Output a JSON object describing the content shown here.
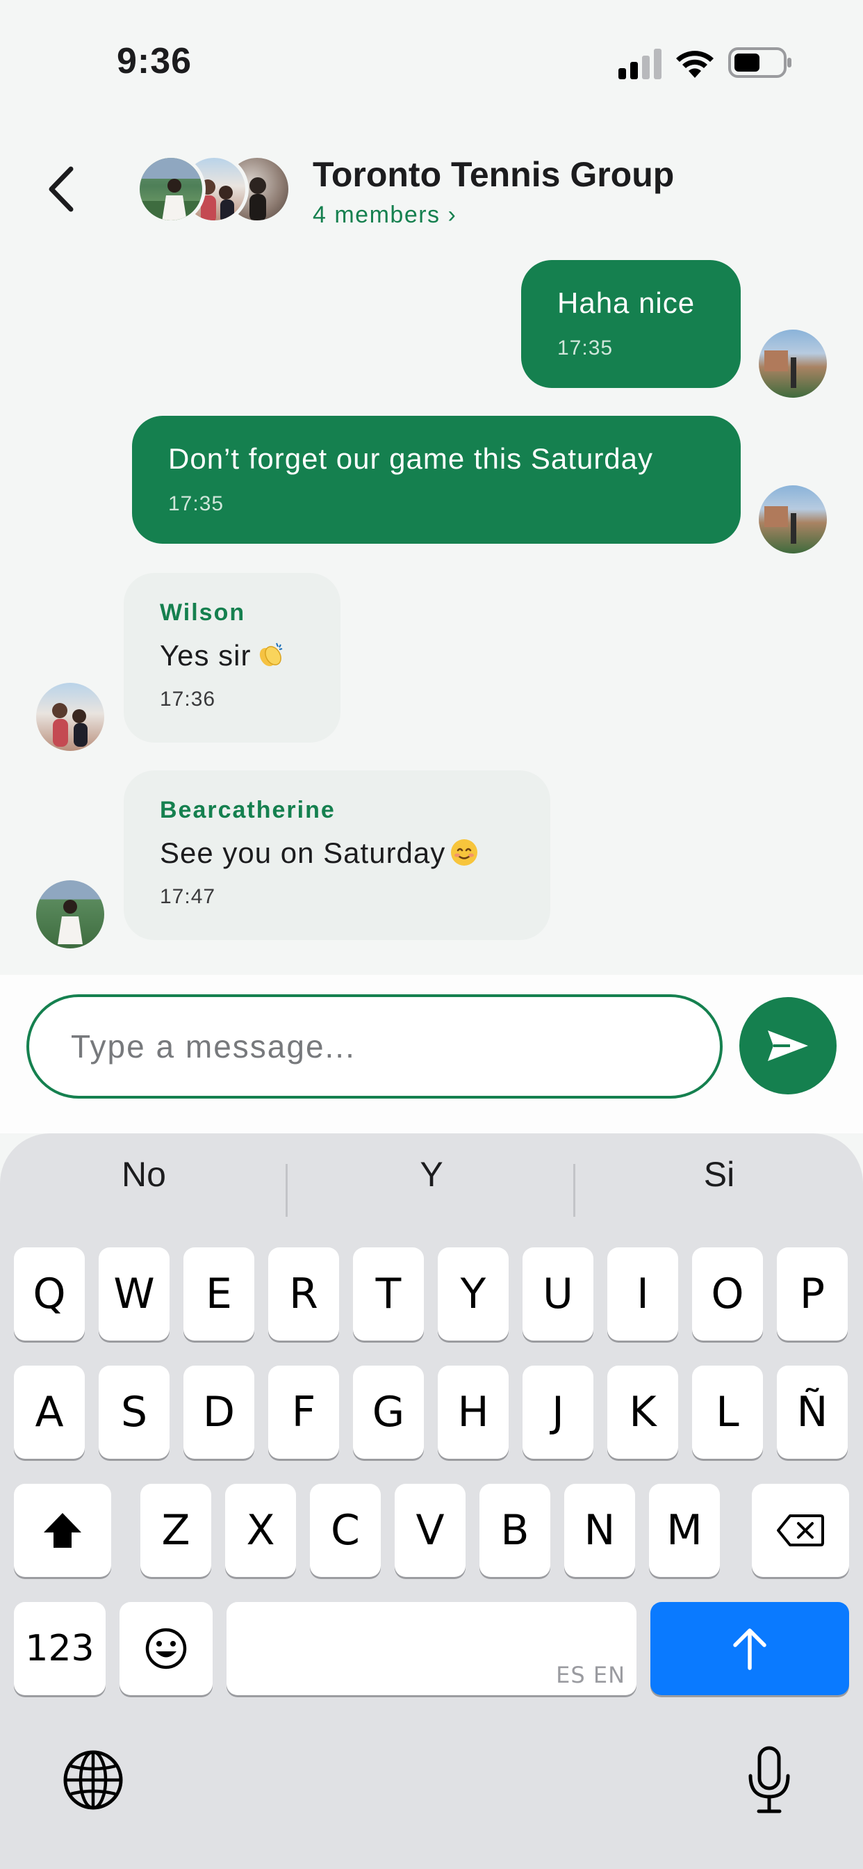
{
  "status_bar": {
    "time": "9:36"
  },
  "header": {
    "back_label": "",
    "title": "Toronto Tennis Group",
    "members": "4 members ›"
  },
  "messages": [
    {
      "direction": "out",
      "text": "Haha nice",
      "time": "17:35"
    },
    {
      "direction": "out",
      "text": "Don’t forget our game this Saturday",
      "time": "17:35"
    },
    {
      "direction": "in",
      "sender": "Wilson",
      "text": "Yes sir",
      "emoji": "clapping-hands",
      "time": "17:36"
    },
    {
      "direction": "in",
      "sender": "Bearcatherine",
      "text": "See you on Saturday",
      "emoji": "smiling-face",
      "time": "17:47"
    }
  ],
  "composer": {
    "placeholder": "Type a message..."
  },
  "keyboard": {
    "suggestions": [
      "No",
      "Y",
      "Si"
    ],
    "row1": [
      "Q",
      "W",
      "E",
      "R",
      "T",
      "Y",
      "U",
      "I",
      "O",
      "P"
    ],
    "row2": [
      "A",
      "S",
      "D",
      "F",
      "G",
      "H",
      "J",
      "K",
      "L",
      "Ñ"
    ],
    "row3": [
      "Z",
      "X",
      "C",
      "V",
      "B",
      "N",
      "M"
    ],
    "numbers_key": "123",
    "space_languages": "ES EN"
  },
  "colors": {
    "accent": "#15804f",
    "return_key": "#0a7aff",
    "keyboard_bg": "#e0e1e4"
  },
  "icons": [
    "signal-icon",
    "wifi-icon",
    "battery-icon",
    "back-chevron-icon",
    "send-icon",
    "shift-icon",
    "backspace-icon",
    "emoji-icon",
    "return-arrow-icon",
    "globe-icon",
    "microphone-icon"
  ]
}
